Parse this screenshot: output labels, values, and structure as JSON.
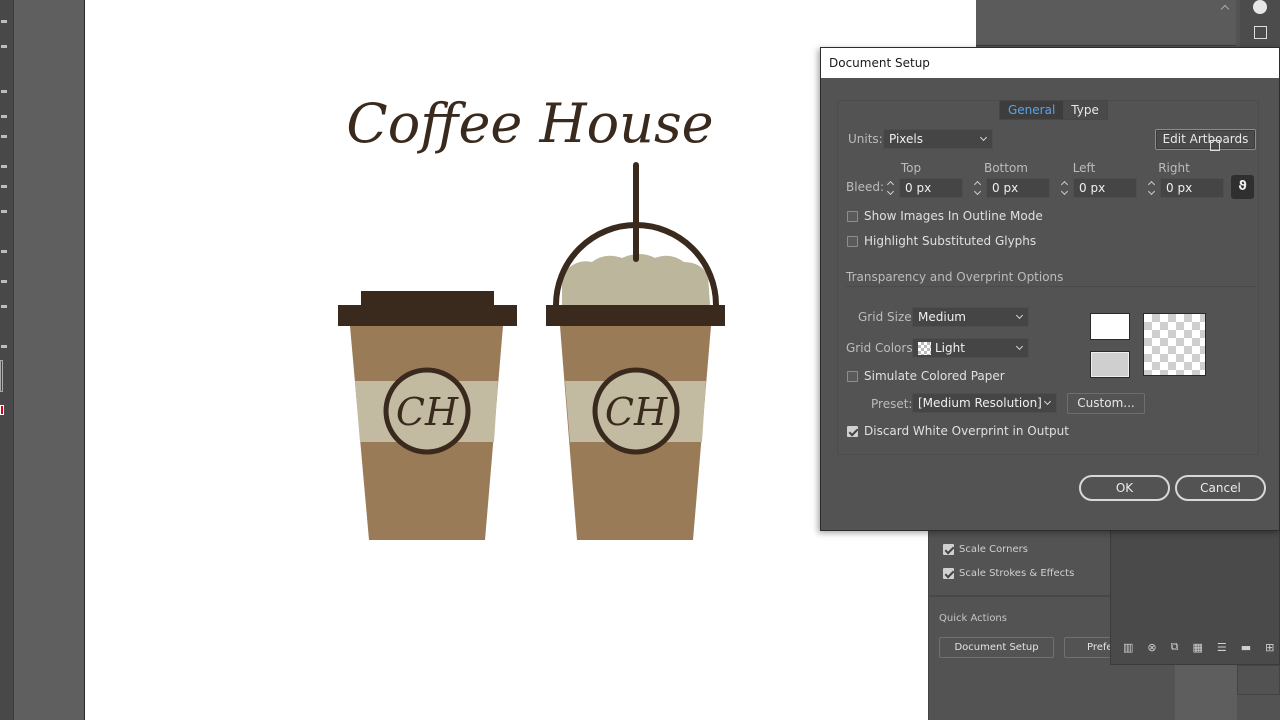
{
  "artwork": {
    "title": "Coffee House",
    "monogram": "CH",
    "colors": {
      "dark_brown": "#3a2a1e",
      "cup_brown": "#9a7b58",
      "sleeve_beige": "#c2bba2",
      "foam": "#bbb69c"
    }
  },
  "dialog": {
    "title": "Document Setup",
    "tabs": [
      {
        "label": "General",
        "active": true
      },
      {
        "label": "Type",
        "active": false
      }
    ],
    "units_label": "Units:",
    "units_value": "Pixels",
    "edit_artboards_label": "Edit Artboards",
    "bleed_label": "Bleed:",
    "bleed": [
      {
        "label": "Top",
        "value": "0 px"
      },
      {
        "label": "Bottom",
        "value": "0 px"
      },
      {
        "label": "Left",
        "value": "0 px"
      },
      {
        "label": "Right",
        "value": "0 px"
      }
    ],
    "link_icon": "link-icon",
    "checkboxes": [
      {
        "label": "Show Images In Outline Mode",
        "checked": false
      },
      {
        "label": "Highlight Substituted Glyphs",
        "checked": false
      }
    ],
    "transparency_section": "Transparency and Overprint Options",
    "grid_size_label": "Grid Size:",
    "grid_size_value": "Medium",
    "grid_colors_label": "Grid Colors:",
    "grid_colors_value": "Light",
    "simulate_paper": {
      "label": "Simulate Colored Paper",
      "checked": false
    },
    "preset_label": "Preset:",
    "preset_value": "[Medium Resolution]",
    "custom_label": "Custom...",
    "discard_overprint": {
      "label": "Discard White Overprint in Output",
      "checked": true
    },
    "ok_label": "OK",
    "cancel_label": "Cancel"
  },
  "properties_panel": {
    "checkboxes": [
      {
        "label": "Scale Corners",
        "checked": true
      },
      {
        "label": "Scale Strokes & Effects",
        "checked": true
      }
    ],
    "quick_actions_label": "Quick Actions",
    "document_setup_label": "Document Setup",
    "preferences_label": "Prefe"
  }
}
